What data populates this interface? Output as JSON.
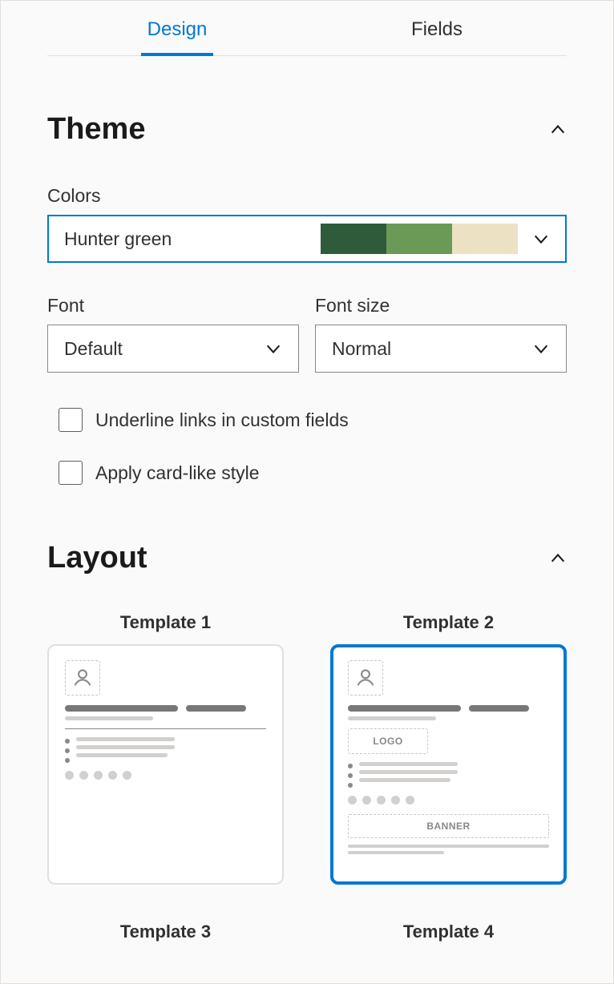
{
  "tabs": {
    "design": "Design",
    "fields": "Fields",
    "active": "design"
  },
  "theme": {
    "title": "Theme",
    "colors_label": "Colors",
    "colors_value": "Hunter green",
    "swatches": [
      "#2f5b3b",
      "#6a9a56",
      "#ece1c3"
    ],
    "font_label": "Font",
    "font_value": "Default",
    "font_size_label": "Font size",
    "font_size_value": "Normal",
    "underline_label": "Underline links in custom fields",
    "underline_checked": false,
    "card_style_label": "Apply card-like style",
    "card_style_checked": false
  },
  "layout": {
    "title": "Layout",
    "templates": [
      {
        "label": "Template 1"
      },
      {
        "label": "Template 2"
      },
      {
        "label": "Template 3"
      },
      {
        "label": "Template 4"
      }
    ],
    "selected_index": 1,
    "placeholders": {
      "logo": "LOGO",
      "banner": "BANNER"
    }
  }
}
